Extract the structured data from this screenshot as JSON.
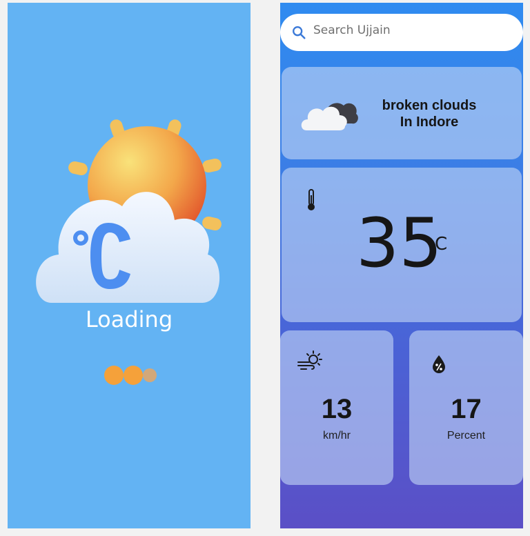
{
  "loading_screen": {
    "loading_text": "Loading",
    "colors": {
      "background": "#63b3f3",
      "dot": "#f5a13a",
      "dot_faded": "#d2a87a"
    }
  },
  "weather_screen": {
    "search": {
      "placeholder": "Search Ujjain",
      "icon": "search-icon"
    },
    "condition": {
      "description": "broken clouds",
      "location": "In Indore",
      "icon": "broken-clouds-icon"
    },
    "temperature": {
      "value": "35",
      "unit": "C",
      "icon": "thermometer-icon"
    },
    "wind": {
      "value": "13",
      "unit": "km/hr",
      "icon": "wind-sun-icon"
    },
    "humidity": {
      "value": "17",
      "unit": "Percent",
      "icon": "humidity-icon"
    }
  }
}
